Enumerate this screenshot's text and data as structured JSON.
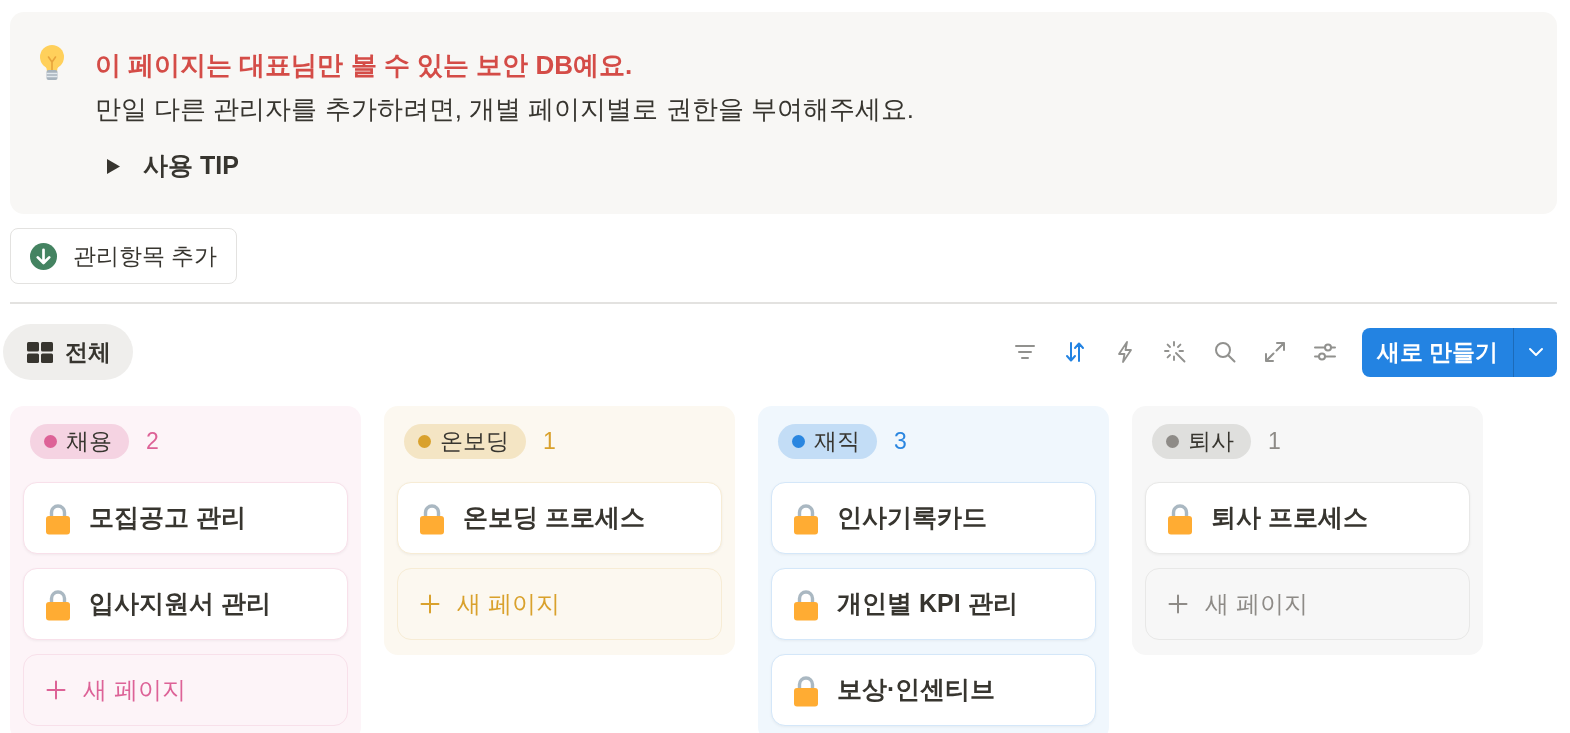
{
  "callout": {
    "title": "이 페이지는 대표님만 볼 수 있는 보안 DB예요.",
    "text": "만일 다른 관리자를 추가하려면, 개별 페이지별로 권한을 부여해주세요.",
    "toggle": {
      "label": "사용 TIP",
      "expanded": false
    }
  },
  "action_button": {
    "label": "관리항목 추가"
  },
  "views": [
    {
      "label": "전체",
      "selected": true
    }
  ],
  "toolbar": [
    {
      "kind": "filter",
      "active": false
    },
    {
      "kind": "sort",
      "active": true
    },
    {
      "kind": "automation",
      "active": false
    },
    {
      "kind": "ai",
      "active": false
    },
    {
      "kind": "search",
      "active": false
    },
    {
      "kind": "expand",
      "active": false
    },
    {
      "kind": "settings",
      "active": false
    }
  ],
  "new_button": {
    "label": "새로 만들기"
  },
  "board": {
    "columns": [
      {
        "label": "채용",
        "count": "2",
        "color": "#dd6297",
        "cards": [
          {
            "title": "모집공고 관리"
          },
          {
            "title": "입사지원서 관리"
          }
        ],
        "new_page": "새 페이지"
      },
      {
        "label": "온보딩",
        "count": "1",
        "color": "#d9a12c",
        "cards": [
          {
            "title": "온보딩 프로세스"
          }
        ],
        "new_page": "새 페이지"
      },
      {
        "label": "재직",
        "count": "3",
        "color": "#2a86e0",
        "cards": [
          {
            "title": "인사기록카드"
          },
          {
            "title": "개인별 KPI 관리"
          },
          {
            "title": "보상·인센티브"
          }
        ]
      },
      {
        "label": "퇴사",
        "count": "1",
        "color": "#8e8b87",
        "cards": [
          {
            "title": "퇴사 프로세스"
          }
        ],
        "new_page": "새 페이지"
      }
    ]
  }
}
